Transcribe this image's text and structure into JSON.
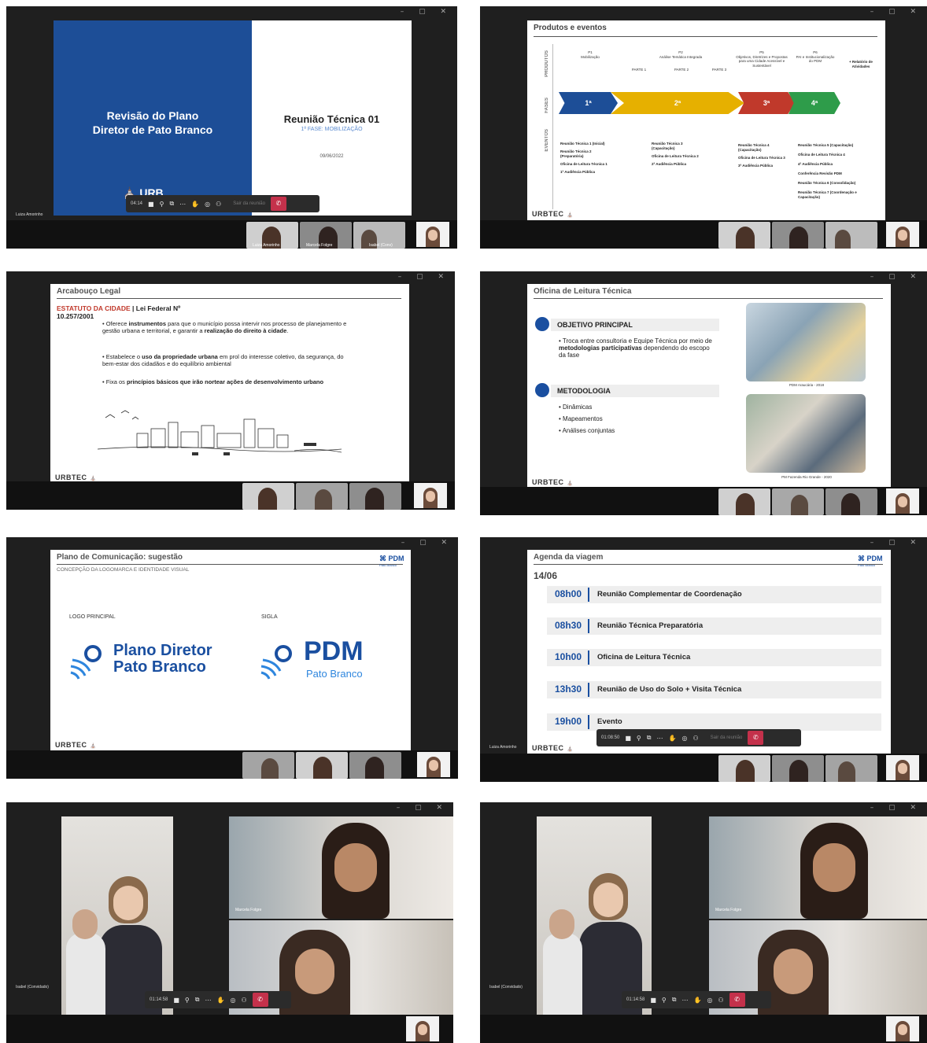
{
  "window_controls": "–  ▢  ✕",
  "shot1": {
    "left_title_l1": "Revisão do Plano",
    "left_title_l2": "Diretor de Pato Branco",
    "right_title": "Reunião Técnica 01",
    "right_subtitle": "1ª FASE: MOBILIZAÇÃO",
    "date": "09/06/2022",
    "logo_text": "URB",
    "timer": "04:14",
    "presenter": "Luiza Amorinho",
    "thumb_names": [
      "Luiza Amorinho",
      "Marcela Folgre",
      "Isabel (Conv)"
    ]
  },
  "shot2": {
    "title": "Produtos e eventos",
    "labels": {
      "produtos": "PRODUTOS",
      "fases": "FASES",
      "eventos": "EVENTOS"
    },
    "products": [
      {
        "l1": "P1",
        "l2": "Mobilização"
      },
      {
        "l1": "PARTE 1",
        "l2": ""
      },
      {
        "l1": "P2",
        "l2": "Análise Temática Integrada"
      },
      {
        "l1": "PARTE 2",
        "l2": ""
      },
      {
        "l1": "PARTE 3",
        "l2": ""
      },
      {
        "l1": "P5",
        "l2": "Objetivos, Diretrizes e Propostas para uma Cidade Acessível e Sustentável"
      },
      {
        "l1": "P6",
        "l2": "PAI e Institucionalização do PDM"
      },
      {
        "l1": "+ Relatório de Atividades",
        "l2": ""
      }
    ],
    "phases": [
      "1ª",
      "2ª",
      "3ª",
      "4ª"
    ],
    "phase_colors": [
      "#1d4e97",
      "#e6b000",
      "#c0392b",
      "#2e9c4a"
    ],
    "events_col1": [
      "Reunião Técnica 1 (Inicial)",
      "Reunião Técnica 2 (Preparatória)",
      "Oficina de Leitura Técnica 1",
      "1ª Audiência Pública"
    ],
    "events_col2": [
      "Reunião Técnica 3 (Capacitação)",
      "Oficina de Leitura Técnica 2",
      "2ª Audiência Pública"
    ],
    "events_col3": [
      "Reunião Técnica 4 (Capacitação)",
      "Oficina de Leitura Técnica 3",
      "3ª Audiência Pública"
    ],
    "events_col4": [
      "Reunião Técnica 5 (Capacitação)",
      "Oficina de Leitura Técnica 4",
      "4ª Audiência Pública",
      "Conferência Revisão PDM",
      "Reunião Técnica 6 (Consolidação)",
      "Reunião Técnica 7 (Coordenação e Capacitação)"
    ],
    "footer": "URBTEC"
  },
  "shot3": {
    "title": "Arcabouço Legal",
    "heading_red": "ESTATUTO DA CIDADE",
    "heading_black": "| Lei Federal Nº",
    "heading_l2": "10.257/2001",
    "b1_a": "Oferece ",
    "b1_b": "instrumentos",
    "b1_c": " para que o município possa intervir nos processo de planejamento e gestão urbana e territorial, e garantir a ",
    "b1_d": "realização do direito à cidade",
    "b1_e": ".",
    "b2_a": "Estabelece o ",
    "b2_b": "uso da propriedade urbana",
    "b2_c": " em prol do interesse coletivo, da segurança, do bem-estar dos cidadãos e do equilíbrio ambiental",
    "b3_a": "Fixa os ",
    "b3_b": "princípios básicos que irão nortear ações de desenvolvimento urbano",
    "footer": "URBTEC"
  },
  "shot4": {
    "title": "Oficina de Leitura Técnica",
    "obj_title": "OBJETIVO PRINCIPAL",
    "obj_a": "Troca entre consultoria e Equipe Técnica por meio de ",
    "obj_b": "metodologias participativas",
    "obj_c": " dependendo do escopo da fase",
    "met_title": "METODOLOGIA",
    "met_items": [
      "Dinâmicas",
      "Mapeamentos",
      "Análises conjuntas"
    ],
    "caption1": "PDM Araucária - 2018",
    "caption2": "PM Fazenda Rio Grande - 2020",
    "footer": "URBTEC"
  },
  "shot5": {
    "title": "Plano de Comunicação: sugestão",
    "subtitle": "CONCEPÇÃO DA LOGOMARCA E IDENTIDADE VISUAL",
    "label_main": "LOGO PRINCIPAL",
    "label_sigla": "SIGLA",
    "logo_l1": "Plano Diretor",
    "logo_l2": "Pato Branco",
    "sigla": "PDM",
    "sigla_sub": "Pato Branco",
    "corner_logo": "PDM",
    "corner_sub": "Pato Branco",
    "footer": "URBTEC"
  },
  "shot6": {
    "title": "Agenda da viagem",
    "date": "14/06",
    "items": [
      {
        "time": "08h00",
        "text": "Reunião Complementar de Coordenação"
      },
      {
        "time": "08h30",
        "text": "Reunião Técnica Preparatória"
      },
      {
        "time": "10h00",
        "text": "Oficina de Leitura Técnica"
      },
      {
        "time": "13h30",
        "text": "Reunião de Uso do Solo + Visita Técnica"
      },
      {
        "time": "19h00",
        "text": "Evento"
      }
    ],
    "timer": "01:08:50",
    "presenter": "Luiza Amorinho",
    "corner_logo": "PDM",
    "corner_sub": "Pato Branco",
    "footer": "URBTEC"
  },
  "shot7": {
    "timer": "01:14:58",
    "names": [
      "Isabel (Convidado)",
      "Marcela Folgre"
    ]
  },
  "shot8": {
    "timer": "01:14:58",
    "names": [
      "Isabel (Convidado)",
      "Marcela Folgre"
    ]
  },
  "toolbar_hint": "Sair da reunião",
  "toolbar_icons": [
    "camera-icon",
    "mic-off-icon",
    "share-icon",
    "more-icon",
    "hand-icon",
    "chat-icon",
    "people-icon",
    "hangup-icon"
  ]
}
